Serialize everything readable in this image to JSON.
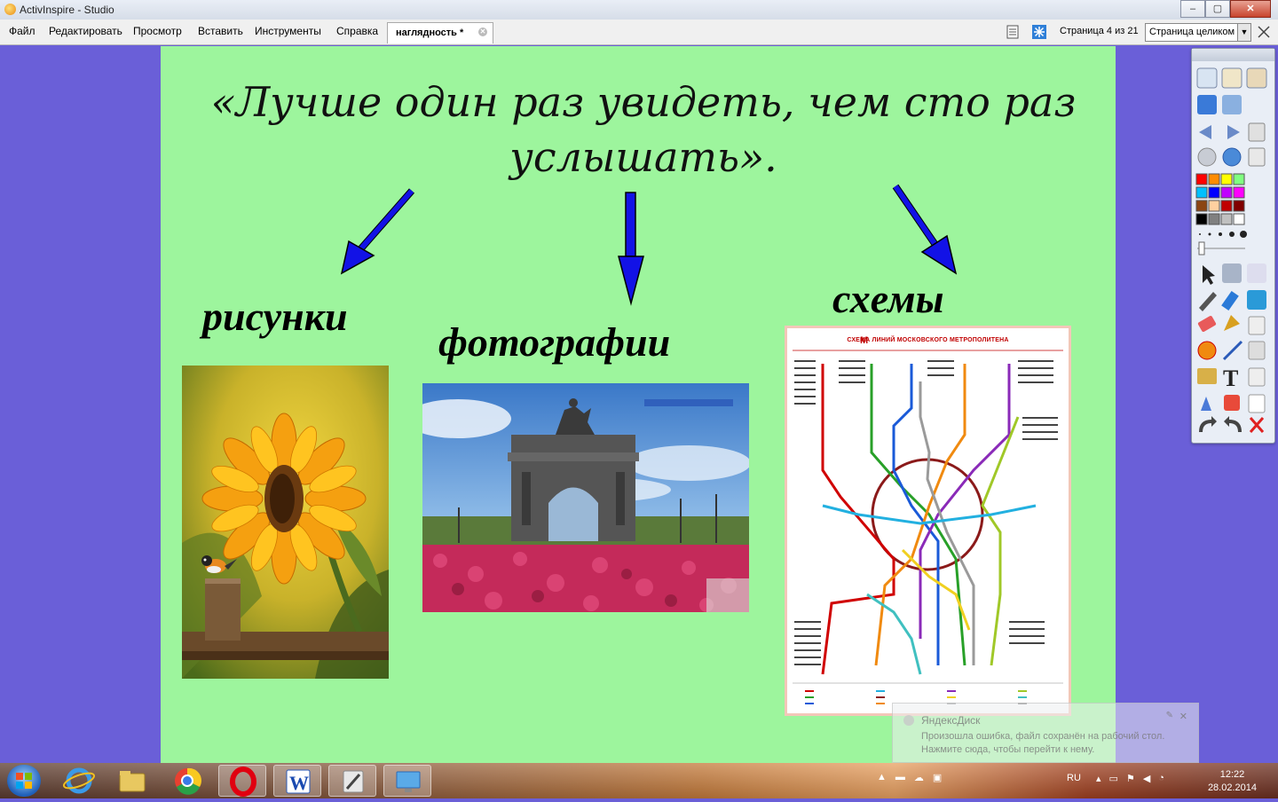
{
  "window": {
    "title": "ActivInspire - Studio"
  },
  "menu": [
    "Файл",
    "Редактировать",
    "Просмотр",
    "Вставить",
    "Инструменты",
    "Справка"
  ],
  "document_tab": {
    "label": "наглядность *"
  },
  "page_info": "Страница 4 из 21",
  "zoom": {
    "selected": "Страница целиком"
  },
  "slide": {
    "quote_line1": "«Лучше один раз увидеть, чем сто раз",
    "quote_line2": "услышать».",
    "label_drawings": "рисунки",
    "label_photos": "фотографии",
    "label_schemes": "схемы",
    "metro_title": "СХЕМА ЛИНИЙ МОСКОВСКОГО МЕТРОПОЛИТЕНА",
    "metro_logo": "М"
  },
  "colors": {
    "desktop": "#6a5fd8",
    "page_background": "#9df59d",
    "arrow": "#1010e0",
    "palette_swatches": [
      "#ff0000",
      "#ff8c00",
      "#ffff00",
      "#80ff80",
      "#00c0ff",
      "#0000ff",
      "#c000ff",
      "#ff00ff",
      "#8b4513",
      "#ffd0a0",
      "#c00000",
      "#800000",
      "#000000",
      "#808080",
      "#c0c0c0",
      "#ffffff"
    ]
  },
  "notification": {
    "title": "ЯндексДиск",
    "message": "Произошла ошибка, файл сохранён на рабочий стол. Нажмите сюда, чтобы перейти к нему."
  },
  "taskbar": {
    "apps": [
      "start-icon",
      "internet-explorer-icon",
      "file-explorer-icon",
      "chrome-icon",
      "opera-icon",
      "word-icon",
      "activinspire-icon",
      "desktop-icon"
    ],
    "language": "RU",
    "time": "12:22",
    "date": "28.02.2014"
  },
  "palette_tools": [
    "main-menu-icon",
    "browsers-icon",
    "pen-icon",
    "desktop-annotate-icon",
    "previous-page-icon",
    "next-page-icon",
    "reset-page-icon",
    "play-icon",
    "web-icon",
    "clear-icon",
    "select-icon",
    "magic-ink-icon",
    "pen-tool-icon",
    "highlighter-icon",
    "eraser-icon",
    "fill-icon",
    "shapes-icon",
    "connector-icon",
    "text-icon",
    "undo-icon",
    "redo-icon",
    "close-palette-icon"
  ]
}
